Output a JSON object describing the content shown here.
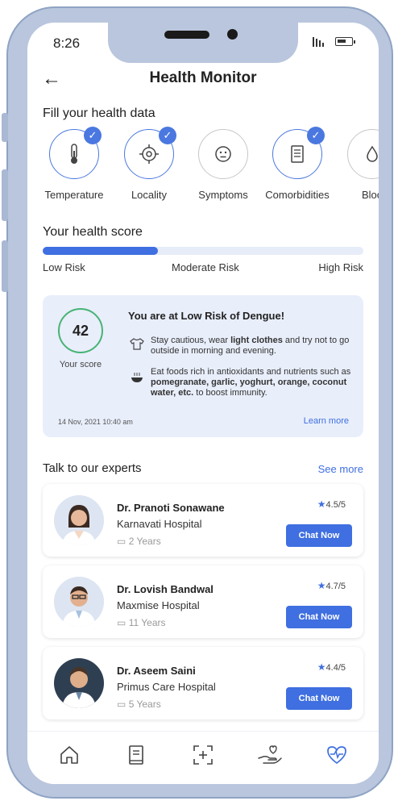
{
  "status": {
    "time": "8:26"
  },
  "header": {
    "title": "Health Monitor",
    "back_glyph": "←"
  },
  "fill_section": {
    "title": "Fill your health data",
    "items": [
      {
        "label": "Temperature",
        "icon": "thermometer-icon",
        "checked": true
      },
      {
        "label": "Locality",
        "icon": "location-target-icon",
        "checked": true
      },
      {
        "label": "Symptoms",
        "icon": "face-icon",
        "checked": false
      },
      {
        "label": "Comorbidities",
        "icon": "document-icon",
        "checked": true
      },
      {
        "label": "Bloo",
        "icon": "blood-drop-icon",
        "checked": false
      }
    ]
  },
  "score_section": {
    "title": "Your health score",
    "progress": 0.36,
    "labels": {
      "low": "Low Risk",
      "moderate": "Moderate Risk",
      "high": "High Risk"
    }
  },
  "risk_card": {
    "score": "42",
    "score_label": "Your score",
    "title": "You are at Low Risk of Dengue!",
    "tip1": "Stay cautious, wear light clothes and try not to go outside in morning and evening.",
    "tip2": "Eat foods rich in antioxidants and nutrients such as pomegranate, garlic, yoghurt, orange, coconut water, etc. to boost immunity.",
    "date": "14 Nov, 2021 10:40 am",
    "learn_more": "Learn more"
  },
  "experts": {
    "title": "Talk to our experts",
    "see_more": "See more",
    "chat_label": "Chat Now",
    "doctors": [
      {
        "name": "Dr. Pranoti Sonawane",
        "hospital": "Karnavati Hospital",
        "experience": "2 Years",
        "rating": "4.5/5"
      },
      {
        "name": "Dr. Lovish Bandwal",
        "hospital": "Maxmise Hospital",
        "experience": "11 Years",
        "rating": "4.7/5"
      },
      {
        "name": "Dr. Aseem Saini",
        "hospital": "Primus Care Hospital",
        "experience": "5 Years",
        "rating": "4.4/5"
      }
    ]
  },
  "colors": {
    "accent": "#3f6fe0",
    "score_ring": "#47b374",
    "card_bg": "#e8eefa",
    "frame": "#b9c6dd"
  }
}
